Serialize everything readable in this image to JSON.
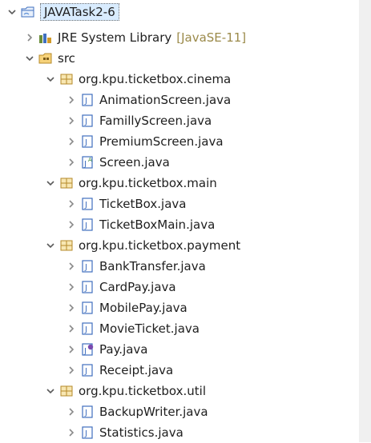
{
  "tree": {
    "project": {
      "label": "JAVATask2-6"
    },
    "jre": {
      "label": "JRE System Library",
      "suffix": "[JavaSE-11]"
    },
    "src": {
      "label": "src"
    },
    "packages": [
      {
        "label": "org.kpu.ticketbox.cinema",
        "files": [
          {
            "label": "AnimationScreen.java",
            "icon": "java-file-icon"
          },
          {
            "label": "FamillyScreen.java",
            "icon": "java-file-icon"
          },
          {
            "label": "PremiumScreen.java",
            "icon": "java-file-icon"
          },
          {
            "label": "Screen.java",
            "icon": "abstract-java-file-icon"
          }
        ]
      },
      {
        "label": "org.kpu.ticketbox.main",
        "files": [
          {
            "label": "TicketBox.java",
            "icon": "java-file-icon"
          },
          {
            "label": "TicketBoxMain.java",
            "icon": "java-file-icon"
          }
        ]
      },
      {
        "label": "org.kpu.ticketbox.payment",
        "files": [
          {
            "label": "BankTransfer.java",
            "icon": "java-file-icon"
          },
          {
            "label": "CardPay.java",
            "icon": "java-file-icon"
          },
          {
            "label": "MobilePay.java",
            "icon": "java-file-icon"
          },
          {
            "label": "MovieTicket.java",
            "icon": "java-file-icon"
          },
          {
            "label": "Pay.java",
            "icon": "interface-java-file-icon"
          },
          {
            "label": "Receipt.java",
            "icon": "java-file-icon"
          }
        ]
      },
      {
        "label": "org.kpu.ticketbox.util",
        "files": [
          {
            "label": "BackupWriter.java",
            "icon": "java-file-icon"
          },
          {
            "label": "Statistics.java",
            "icon": "java-file-icon"
          }
        ]
      }
    ]
  }
}
